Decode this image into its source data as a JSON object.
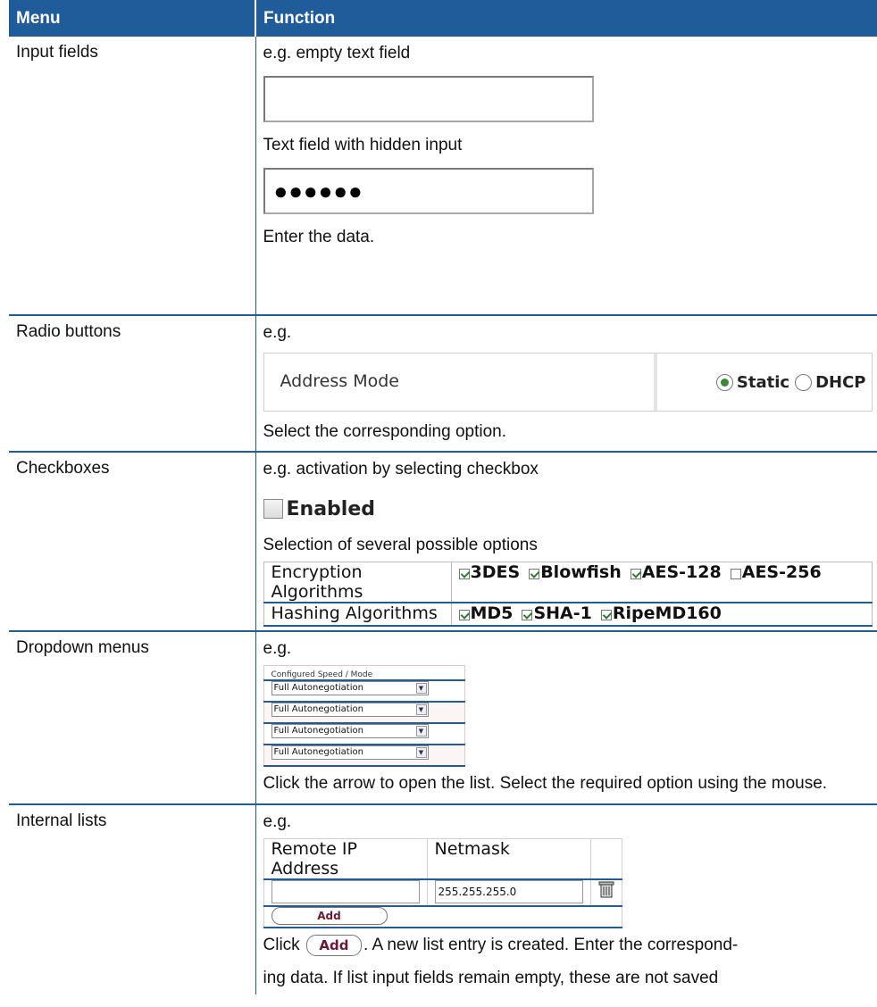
{
  "header": {
    "menu": "Menu",
    "function": "Function"
  },
  "rows": {
    "input": {
      "menu": "Input fields",
      "line1": "e.g. empty text field",
      "line2": "Text field with hidden input",
      "hidden_value": "●●●●●●",
      "line3": "Enter the data."
    },
    "radio": {
      "menu": "Radio buttons",
      "line1": "e.g.",
      "label": "Address Mode",
      "opt1": "Static",
      "opt2": "DHCP",
      "line2": "Select the corresponding option."
    },
    "checkbox": {
      "menu": "Checkboxes",
      "line1": "e.g. activation by selecting checkbox",
      "enabled": "Enabled",
      "line2": "Selection of several possible options",
      "enc_label": "Encryption Algorithms",
      "enc_opts": [
        "3DES",
        "Blowfish",
        "AES-128",
        "AES-256"
      ],
      "hash_label": "Hashing Algorithms",
      "hash_opts": [
        "MD5",
        "SHA-1",
        "RipeMD160"
      ]
    },
    "dropdown": {
      "menu": "Dropdown menus",
      "line1": "e.g.",
      "header": "Configured Speed / Mode",
      "options": [
        "Full Autonegotiation",
        "Full Autonegotiation",
        "Full Autonegotiation",
        "Full Autonegotiation"
      ],
      "text": "Click the arrow to open the list. Select the required option using the mouse."
    },
    "internal": {
      "menu": "Internal lists",
      "line1": "e.g.",
      "col1": "Remote IP Address",
      "col2": "Netmask",
      "netmask_value": "255.255.255.0",
      "add": "Add",
      "text_pre": "Click",
      "text_post": ". A new list entry is created. Enter the correspond-",
      "text2": "ing data. If list input fields remain empty, these are not saved"
    }
  }
}
